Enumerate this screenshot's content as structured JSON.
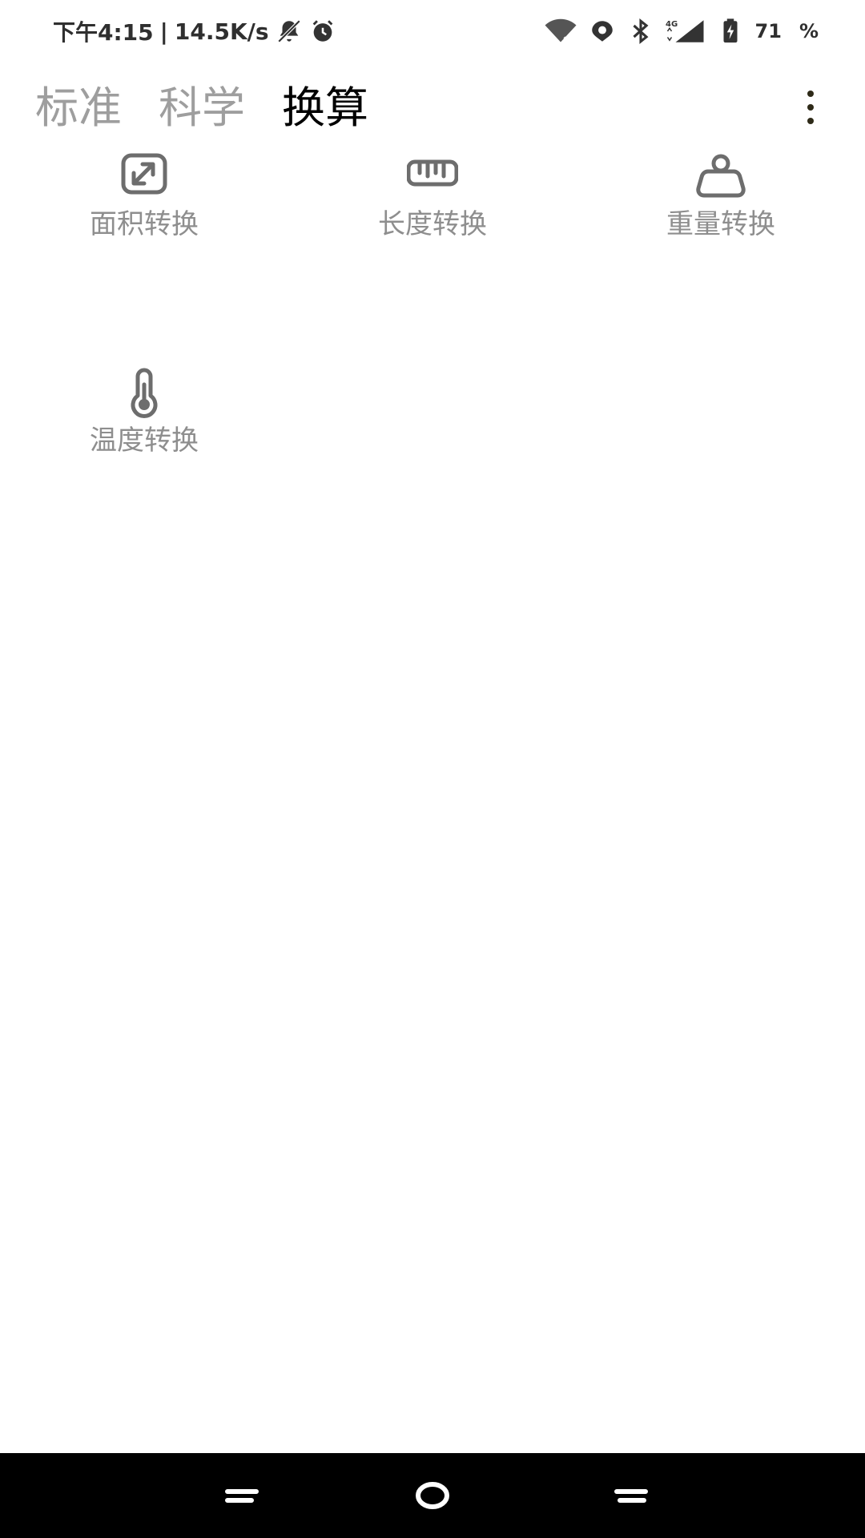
{
  "status_bar": {
    "time": "下午4:15",
    "separator": "|",
    "speed": "14.5K/s",
    "network": "4G",
    "battery": "71",
    "percent": "%"
  },
  "tabs": [
    {
      "label": "标准",
      "active": false
    },
    {
      "label": "科学",
      "active": false
    },
    {
      "label": "换算",
      "active": true
    }
  ],
  "converters": [
    {
      "label": "面积转换",
      "icon": "area-expand-icon"
    },
    {
      "label": "长度转换",
      "icon": "ruler-icon"
    },
    {
      "label": "重量转换",
      "icon": "weight-icon"
    },
    {
      "label": "温度转换",
      "icon": "thermometer-icon"
    }
  ],
  "icons": {
    "more": "more-vert-icon",
    "back": "nav-menu-icon",
    "home": "nav-home-icon",
    "recent": "nav-recents-icon"
  }
}
